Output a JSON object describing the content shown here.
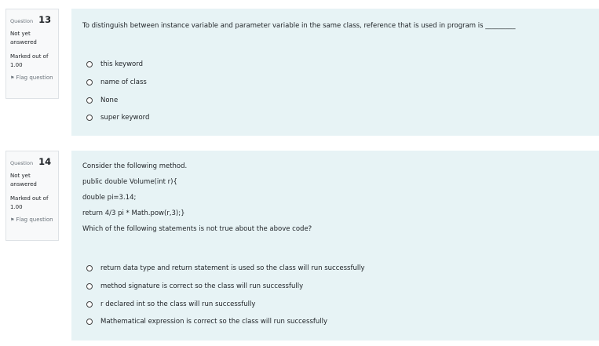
{
  "questions": [
    {
      "label": "Question",
      "number": "13",
      "state": "Not yet answered",
      "grade": "Marked out of 1.00",
      "flag": "Flag question",
      "text": [
        "To distinguish between instance variable and parameter variable in the same class, reference that is used in program is _________"
      ],
      "options": [
        "this keyword",
        "name of class",
        "None",
        "super keyword"
      ]
    },
    {
      "label": "Question",
      "number": "14",
      "state": "Not yet answered",
      "grade": "Marked out of 1.00",
      "flag": "Flag question",
      "text": [
        "Consider the following method.",
        "public double Volume(int r){",
        "double pi=3.14;",
        "return 4/3 pi * Math.pow(r,3);}",
        "Which of the following statements is not true about the above code?"
      ],
      "options": [
        "return data type and return statement is used so the class will run successfully",
        "method signature is correct so the class will run successfully",
        "r declared int so the class will run successfully",
        "Mathematical expression is correct so the class will run successfully"
      ]
    }
  ],
  "icons": {
    "flag": "flag-icon",
    "radio": "radio-unchecked-icon"
  }
}
